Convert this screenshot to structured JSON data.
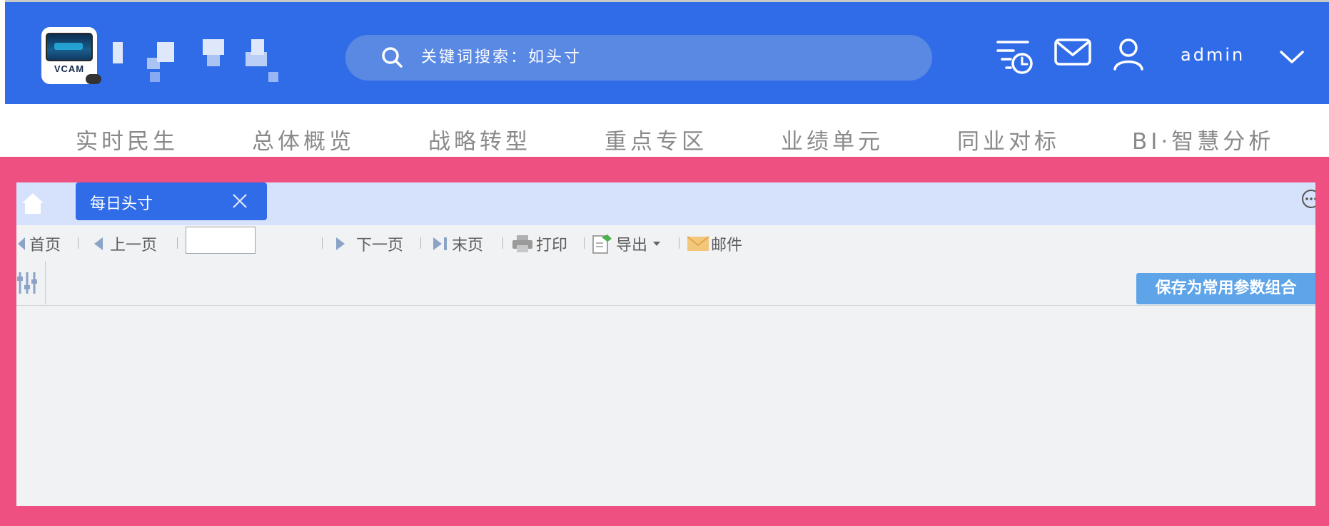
{
  "header": {
    "logo_text": "VCAM",
    "search_placeholder": "关键词搜索：如头寸",
    "username": "admin",
    "icons": [
      "history-icon",
      "mail-icon",
      "user-icon",
      "chevron-down-icon"
    ]
  },
  "nav": {
    "items": [
      "实时民生",
      "总体概览",
      "战略转型",
      "重点专区",
      "业绩单元",
      "同业对标",
      "BI·智慧分析"
    ]
  },
  "tabs": [
    {
      "label": "每日头寸"
    }
  ],
  "toolbar": {
    "first": "首页",
    "prev": "上一页",
    "page_value": "",
    "next": "下一页",
    "last": "末页",
    "print": "打印",
    "export": "导出",
    "mail": "邮件"
  },
  "params": {
    "save_label": "保存为常用参数组合"
  },
  "colors": {
    "header_bg": "#316ce8",
    "frame": "#ee5081",
    "tab_active": "#316ce8",
    "save_button": "#5ea4e8"
  }
}
